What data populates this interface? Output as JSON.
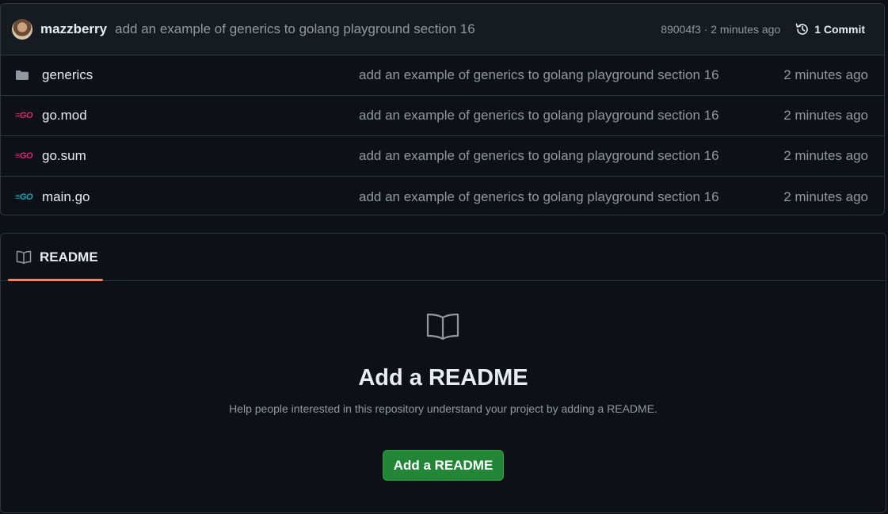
{
  "commit": {
    "author": "mazzberry",
    "message": "add an example of generics to golang playground section 16",
    "sha_and_time": "89004f3 · 2 minutes ago",
    "commits_label": "1 Commit"
  },
  "files": [
    {
      "name": "generics",
      "type": "folder",
      "message": "add an example of generics to golang playground section 16",
      "age": "2 minutes ago"
    },
    {
      "name": "go.mod",
      "type": "go-mod",
      "message": "add an example of generics to golang playground section 16",
      "age": "2 minutes ago"
    },
    {
      "name": "go.sum",
      "type": "go-mod",
      "message": "add an example of generics to golang playground section 16",
      "age": "2 minutes ago"
    },
    {
      "name": "main.go",
      "type": "go",
      "message": "add an example of generics to golang playground section 16",
      "age": "2 minutes ago"
    }
  ],
  "file_icons": {
    "go_glyph": "≡GO"
  },
  "readme": {
    "tab_label": "README",
    "heading": "Add a README",
    "subtext": "Help people interested in this repository understand your project by adding a README.",
    "button_label": "Add a README"
  },
  "colors": {
    "background": "#0d1117",
    "header_bg": "#161b22",
    "border": "#30363d",
    "muted_text": "#9198a1",
    "tab_underline": "#f78166",
    "button_green": "#238636",
    "go_mod_icon": "#db2777",
    "go_file_icon": "#15aabf",
    "folder_icon": "#9198a1"
  }
}
